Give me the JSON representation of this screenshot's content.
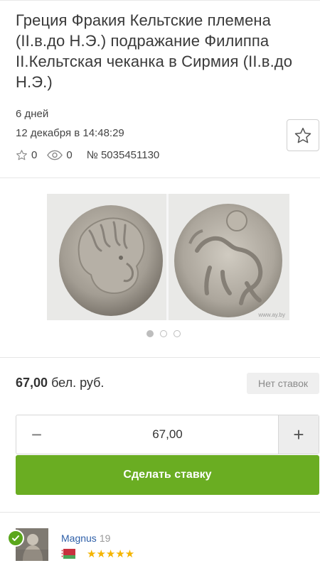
{
  "lot": {
    "title": "Греция Фракия Кельтские племена (II.в.до Н.Э.) подражание Филиппа II.Кельтская чеканка в Сирмия (II.в.до Н.Э.)",
    "time_left": "6 дней",
    "end_date": "12 декабря в 14:48:29",
    "favorites_count": "0",
    "views_count": "0",
    "lot_number": "№ 5035451130"
  },
  "gallery": {
    "watermark": "www.ay.by",
    "slide_count": 3,
    "active_slide": 1
  },
  "bid": {
    "price_value": "67,00",
    "price_currency": "бел. руб.",
    "status_badge": "Нет ставок",
    "stepper_value": "67,00",
    "minus_symbol": "−",
    "plus_symbol": "+",
    "submit_label": "Сделать ставку"
  },
  "seller": {
    "name": "Magnus",
    "rating": "19",
    "stars": "★★★★★",
    "country_flag": "belarus-flag-icon"
  },
  "colors": {
    "accent_green": "#6aad22",
    "link_blue": "#2e5fa8",
    "star_yellow": "#f4b400"
  },
  "icons": [
    "star-outline-icon",
    "eye-icon",
    "favorite-star-icon",
    "verified-check-icon"
  ]
}
